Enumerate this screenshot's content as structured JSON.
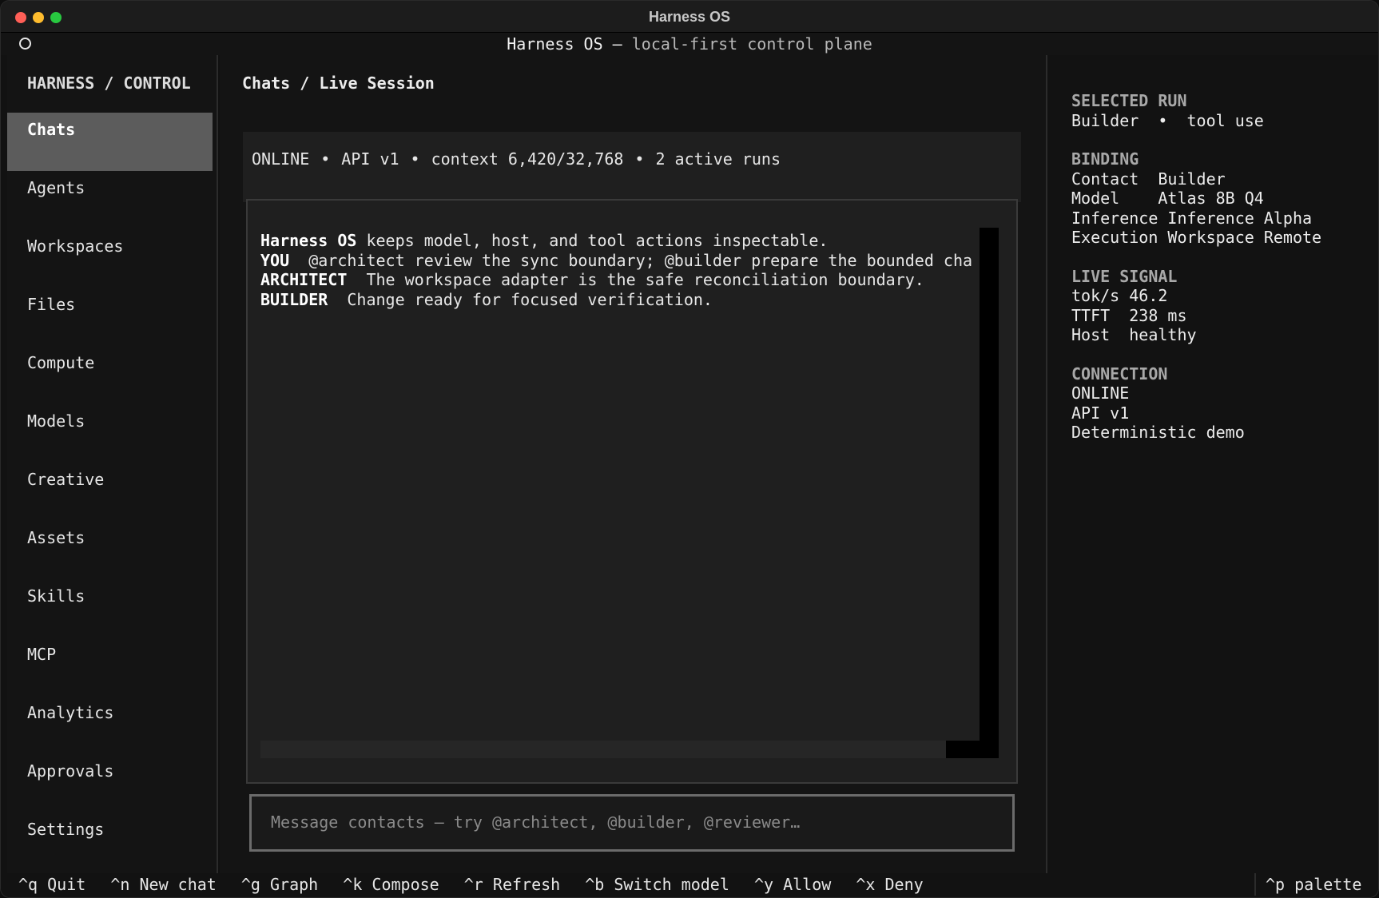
{
  "window": {
    "title": "Harness OS"
  },
  "header": {
    "title_main": "Harness OS —",
    "title_sub": "local-first control plane"
  },
  "sidebar": {
    "title": "HARNESS / CONTROL",
    "items": [
      {
        "label": "Chats",
        "active": true
      },
      {
        "label": "Agents"
      },
      {
        "label": "Workspaces"
      },
      {
        "label": "Files"
      },
      {
        "label": "Compute"
      },
      {
        "label": "Models"
      },
      {
        "label": "Creative"
      },
      {
        "label": "Assets"
      },
      {
        "label": "Skills"
      },
      {
        "label": "MCP"
      },
      {
        "label": "Analytics"
      },
      {
        "label": "Approvals"
      },
      {
        "label": "Settings"
      }
    ]
  },
  "main": {
    "breadcrumb": "Chats / Live Session",
    "status": {
      "connection": "ONLINE",
      "api": "API v1",
      "context": "context 6,420/32,768",
      "runs": "2 active runs",
      "separator": "•"
    },
    "chat": {
      "messages": [
        {
          "speaker": "Harness OS",
          "text": " keeps model, host, and tool actions inspectable."
        },
        {
          "speaker": "YOU",
          "text": "  @architect review the sync boundary; @builder prepare the bounded cha"
        },
        {
          "speaker": "ARCHITECT",
          "text": "  The workspace adapter is the safe reconciliation boundary."
        },
        {
          "speaker": "BUILDER",
          "text": "  Change ready for focused verification."
        }
      ]
    },
    "composer": {
      "placeholder": "Message contacts — try @architect, @builder, @reviewer…"
    }
  },
  "right_panel": {
    "selected_run": {
      "heading": "SELECTED RUN",
      "line": "Builder  •  tool use"
    },
    "binding": {
      "heading": "BINDING",
      "lines": [
        "Contact  Builder",
        "Model    Atlas 8B Q4",
        "Inference Inference Alpha",
        "Execution Workspace Remote"
      ]
    },
    "live_signal": {
      "heading": "LIVE SIGNAL",
      "lines": [
        "tok/s 46.2",
        "TTFT  238 ms",
        "Host  healthy"
      ]
    },
    "connection": {
      "heading": "CONNECTION",
      "lines": [
        "ONLINE",
        "API v1",
        "Deterministic demo"
      ]
    }
  },
  "footer": {
    "shortcuts": [
      {
        "key": "^q",
        "label": "Quit"
      },
      {
        "key": "^n",
        "label": "New chat"
      },
      {
        "key": "^g",
        "label": "Graph"
      },
      {
        "key": "^k",
        "label": "Compose"
      },
      {
        "key": "^r",
        "label": "Refresh"
      },
      {
        "key": "^b",
        "label": "Switch model"
      },
      {
        "key": "^y",
        "label": "Allow"
      },
      {
        "key": "^x",
        "label": "Deny"
      }
    ],
    "palette": {
      "key": "^p",
      "label": "palette"
    }
  },
  "colors": {
    "traffic_red": "#ff5f57",
    "traffic_yellow": "#febc2e",
    "traffic_green": "#28c840",
    "active_nav_bg": "#5c5c5c",
    "panel_bg": "#1f1f1f"
  }
}
